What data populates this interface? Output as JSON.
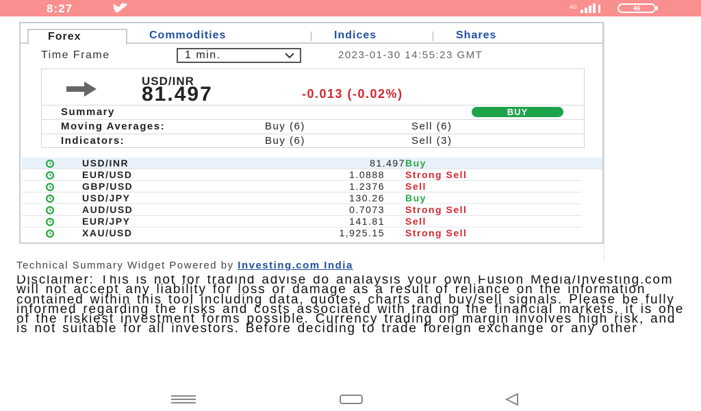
{
  "status_bar": {
    "time": "8:27",
    "battery": "46",
    "icons": [
      "twitter-icon",
      "signal-icon",
      "battery-icon"
    ],
    "background": "#f98f8f"
  },
  "tabs": [
    {
      "label": "Forex",
      "active": true
    },
    {
      "label": "Commodities",
      "active": false
    },
    {
      "label": "Indices",
      "active": false
    },
    {
      "label": "Shares",
      "active": false
    }
  ],
  "time_frame": {
    "label": "Time Frame",
    "selected": "1 min.",
    "timestamp": "2023-01-30 14:55:23 GMT"
  },
  "summary": {
    "pair": "USD/INR",
    "price": "81.497",
    "change": "-0.013 (-0.02%)",
    "summary_label": "Summary",
    "summary_signal": "BUY",
    "moving_averages": {
      "label": "Moving Averages:",
      "buy": "Buy (6)",
      "sell": "Sell (6)"
    },
    "indicators": {
      "label": "Indicators:",
      "buy": "Buy (6)",
      "sell": "Sell (3)"
    }
  },
  "quotes": [
    {
      "symbol": "USD/INR",
      "value": "81.497",
      "signal": "Buy",
      "type": "buy"
    },
    {
      "symbol": "EUR/USD",
      "value": "1.0888",
      "signal": "Strong Sell",
      "type": "sell"
    },
    {
      "symbol": "GBP/USD",
      "value": "1.2376",
      "signal": "Sell",
      "type": "sell"
    },
    {
      "symbol": "USD/JPY",
      "value": "130.26",
      "signal": "Buy",
      "type": "buy"
    },
    {
      "symbol": "AUD/USD",
      "value": "0.7073",
      "signal": "Strong Sell",
      "type": "sell"
    },
    {
      "symbol": "EUR/JPY",
      "value": "141.81",
      "signal": "Sell",
      "type": "sell"
    },
    {
      "symbol": "XAU/USD",
      "value": "1,925.15",
      "signal": "Strong Sell",
      "type": "sell"
    }
  ],
  "powered_by": {
    "text": "Technical Summary Widget Powered by ",
    "link": "Investing.com India"
  },
  "disclaimer": "Disclaimer: This is not for tradind advise do analaysis your own Fusion Media/Investing.com will not accept any liability for loss or damage as a result of reliance on the information contained within this tool including data, quotes, charts and buy/sell signals. Please be fully informed regarding the risks and costs associated with trading the financial markets, it is one of the riskiest investment forms possible. Currency trading on margin involves high risk, and is not suitable for all investors. Before deciding to trade foreign exchange or any other",
  "colors": {
    "buy": "#27a844",
    "sell": "#d5252e",
    "link": "#1f4e9e",
    "pill": "#1fa34a"
  }
}
